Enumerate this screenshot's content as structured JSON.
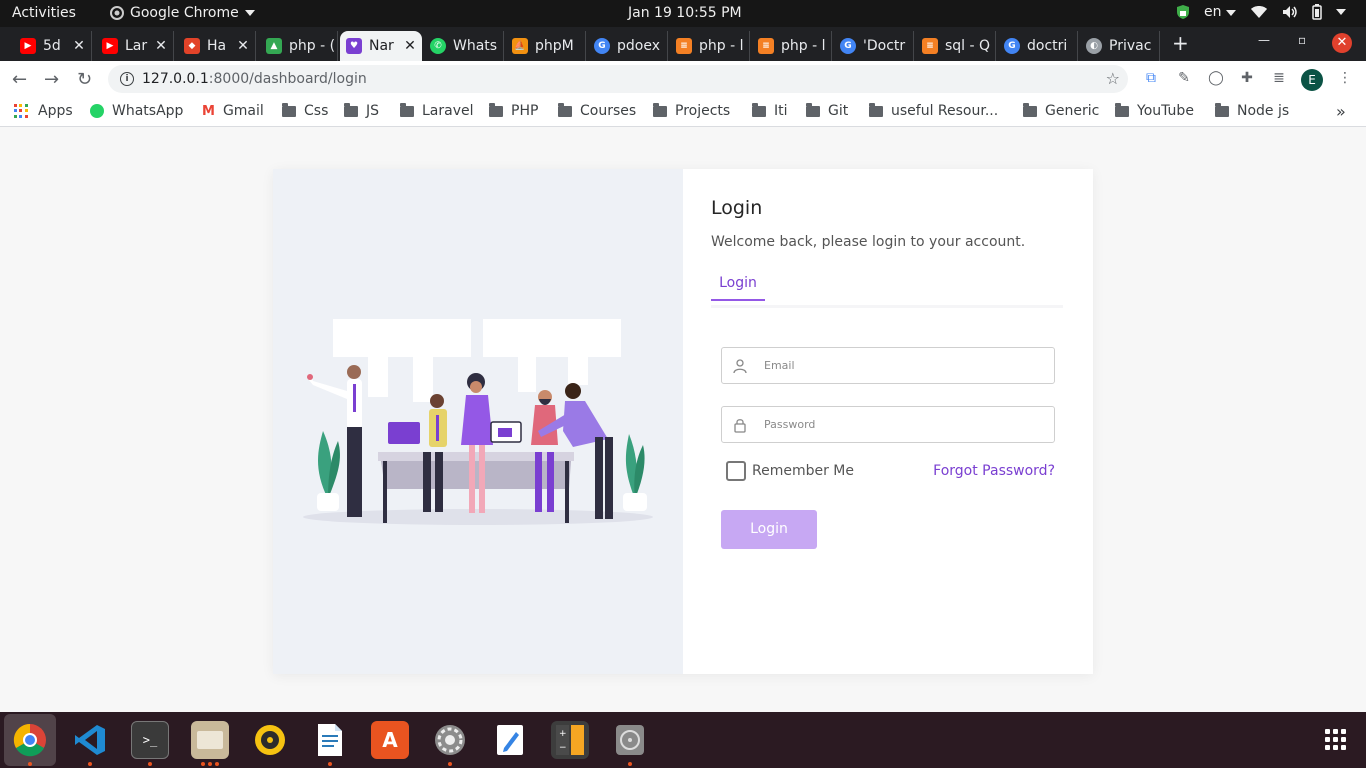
{
  "topbar": {
    "activities": "Activities",
    "app_name": "Google Chrome",
    "clock": "Jan 19  10:55 PM",
    "lang": "en"
  },
  "tabs": [
    {
      "label": "5d",
      "icon": "youtube-icon",
      "color": "#ff0000"
    },
    {
      "label": "Lar",
      "icon": "youtube-icon",
      "color": "#ff0000"
    },
    {
      "label": "Ha",
      "icon": "gitlab-icon",
      "color": "#e24329"
    },
    {
      "label": "php - (",
      "icon": "drive-icon",
      "color": "#34a853"
    },
    {
      "label": "Nar",
      "icon": "heart-icon",
      "color": "#7a3fd1"
    },
    {
      "label": "Whats",
      "icon": "whatsapp-icon",
      "color": "#25d366"
    },
    {
      "label": "phpM",
      "icon": "phpmyadmin-icon",
      "color": "#f29111"
    },
    {
      "label": "pdoex",
      "icon": "google-icon",
      "color": "#4285f4"
    },
    {
      "label": "php - l",
      "icon": "stackoverflow-icon",
      "color": "#f48024"
    },
    {
      "label": "php - l",
      "icon": "stackoverflow-icon",
      "color": "#f48024"
    },
    {
      "label": "'Doctr",
      "icon": "google-icon",
      "color": "#4285f4"
    },
    {
      "label": "sql - Q",
      "icon": "stackoverflow-icon",
      "color": "#f48024"
    },
    {
      "label": "doctri",
      "icon": "google-icon",
      "color": "#4285f4"
    },
    {
      "label": "Privac",
      "icon": "privacy-icon",
      "color": "#9aa0a6"
    }
  ],
  "address": {
    "host": "127.0.0.1",
    "path": ":8000/dashboard/login"
  },
  "profile_initial": "E",
  "bookmarks": [
    {
      "label": "Apps",
      "type": "apps"
    },
    {
      "label": "WhatsApp",
      "type": "whatsapp"
    },
    {
      "label": "Gmail",
      "type": "gmail"
    },
    {
      "label": "Css",
      "type": "folder"
    },
    {
      "label": "JS",
      "type": "folder"
    },
    {
      "label": "Laravel",
      "type": "folder"
    },
    {
      "label": "PHP",
      "type": "folder"
    },
    {
      "label": "Courses",
      "type": "folder"
    },
    {
      "label": "Projects",
      "type": "folder"
    },
    {
      "label": "Iti",
      "type": "folder"
    },
    {
      "label": "Git",
      "type": "folder"
    },
    {
      "label": "useful Resour...",
      "type": "folder"
    },
    {
      "label": "Generic",
      "type": "folder"
    },
    {
      "label": "YouTube",
      "type": "folder"
    },
    {
      "label": "Node js",
      "type": "folder"
    }
  ],
  "login": {
    "title": "Login",
    "subtitle": "Welcome back, please login to your account.",
    "tab": "Login",
    "email_placeholder": "Email",
    "password_placeholder": "Password",
    "remember": "Remember Me",
    "forgot": "Forgot Password?",
    "submit": "Login"
  },
  "colors": {
    "accent": "#7a3fd1",
    "button": "#c7a8f3",
    "illustration_bg": "#eef1f6"
  },
  "dock": [
    {
      "name": "chrome-icon",
      "running": true
    },
    {
      "name": "vscode-icon",
      "running": true
    },
    {
      "name": "terminal-icon",
      "running": true
    },
    {
      "name": "files-icon",
      "running": true
    },
    {
      "name": "rhythmbox-icon",
      "running": false
    },
    {
      "name": "writer-icon",
      "running": true
    },
    {
      "name": "software-icon",
      "running": false
    },
    {
      "name": "settings-icon",
      "running": true
    },
    {
      "name": "text-editor-icon",
      "running": false
    },
    {
      "name": "calculator-icon",
      "running": false
    },
    {
      "name": "disk-icon",
      "running": true
    }
  ]
}
